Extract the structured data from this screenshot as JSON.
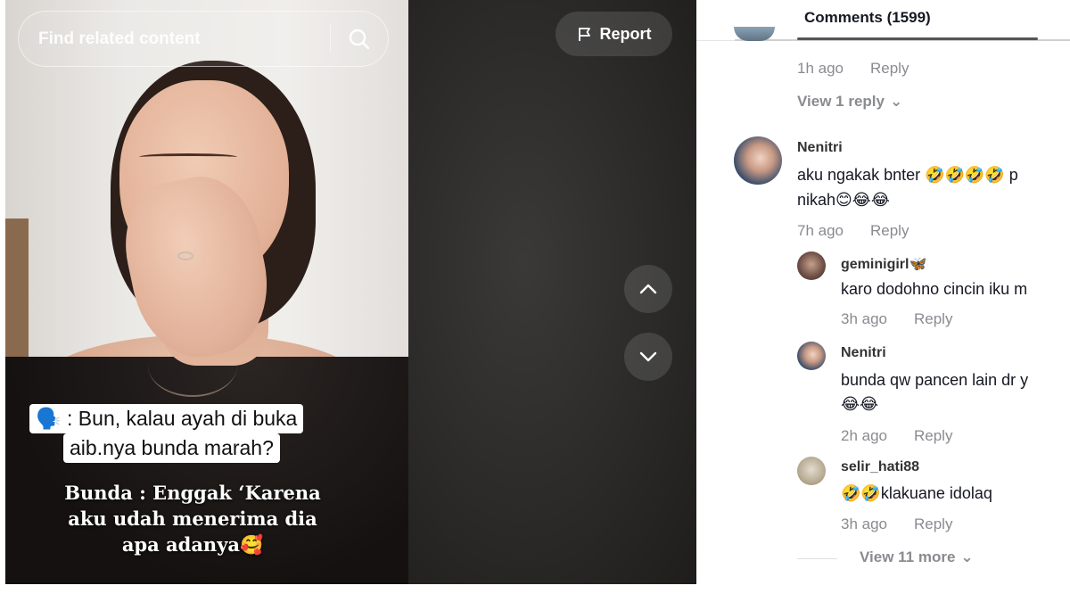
{
  "search": {
    "placeholder": "Find related content"
  },
  "report": {
    "label": "Report"
  },
  "captions": {
    "question_line1": "🗣️ : Bun, kalau ayah di buka",
    "question_line2": "aib.nya bunda marah?",
    "answer": "Bunda : Enggak ‘Karena aku udah menerima dia apa adanya🥰"
  },
  "comments_panel": {
    "title": "Comments (1599)",
    "top_fragment": {
      "time": "1h ago",
      "reply_label": "Reply",
      "view_replies": "View 1 reply"
    },
    "comments": [
      {
        "username": "Nenitri",
        "text_line1": "aku ngakak bnter 🤣🤣🤣🤣 p",
        "text_line2": "nikah😊😂😂",
        "time": "7h ago",
        "reply_label": "Reply"
      }
    ],
    "replies": [
      {
        "username": "geminigirl🦋",
        "text": "karo dodohno cincin iku m",
        "time": "3h ago",
        "reply_label": "Reply"
      },
      {
        "username": "Nenitri",
        "text_line1": "bunda qw pancen lain dr y",
        "text_line2": "😂😂",
        "time": "2h ago",
        "reply_label": "Reply"
      },
      {
        "username": "selir_hati88",
        "text": "🤣🤣klakuane idolaq",
        "time": "3h ago",
        "reply_label": "Reply"
      }
    ],
    "view_more": "View 11 more"
  },
  "colors": {
    "panel_text": "#161823",
    "meta_text": "#8a8b91",
    "player_bg": "#1c1b1b"
  }
}
